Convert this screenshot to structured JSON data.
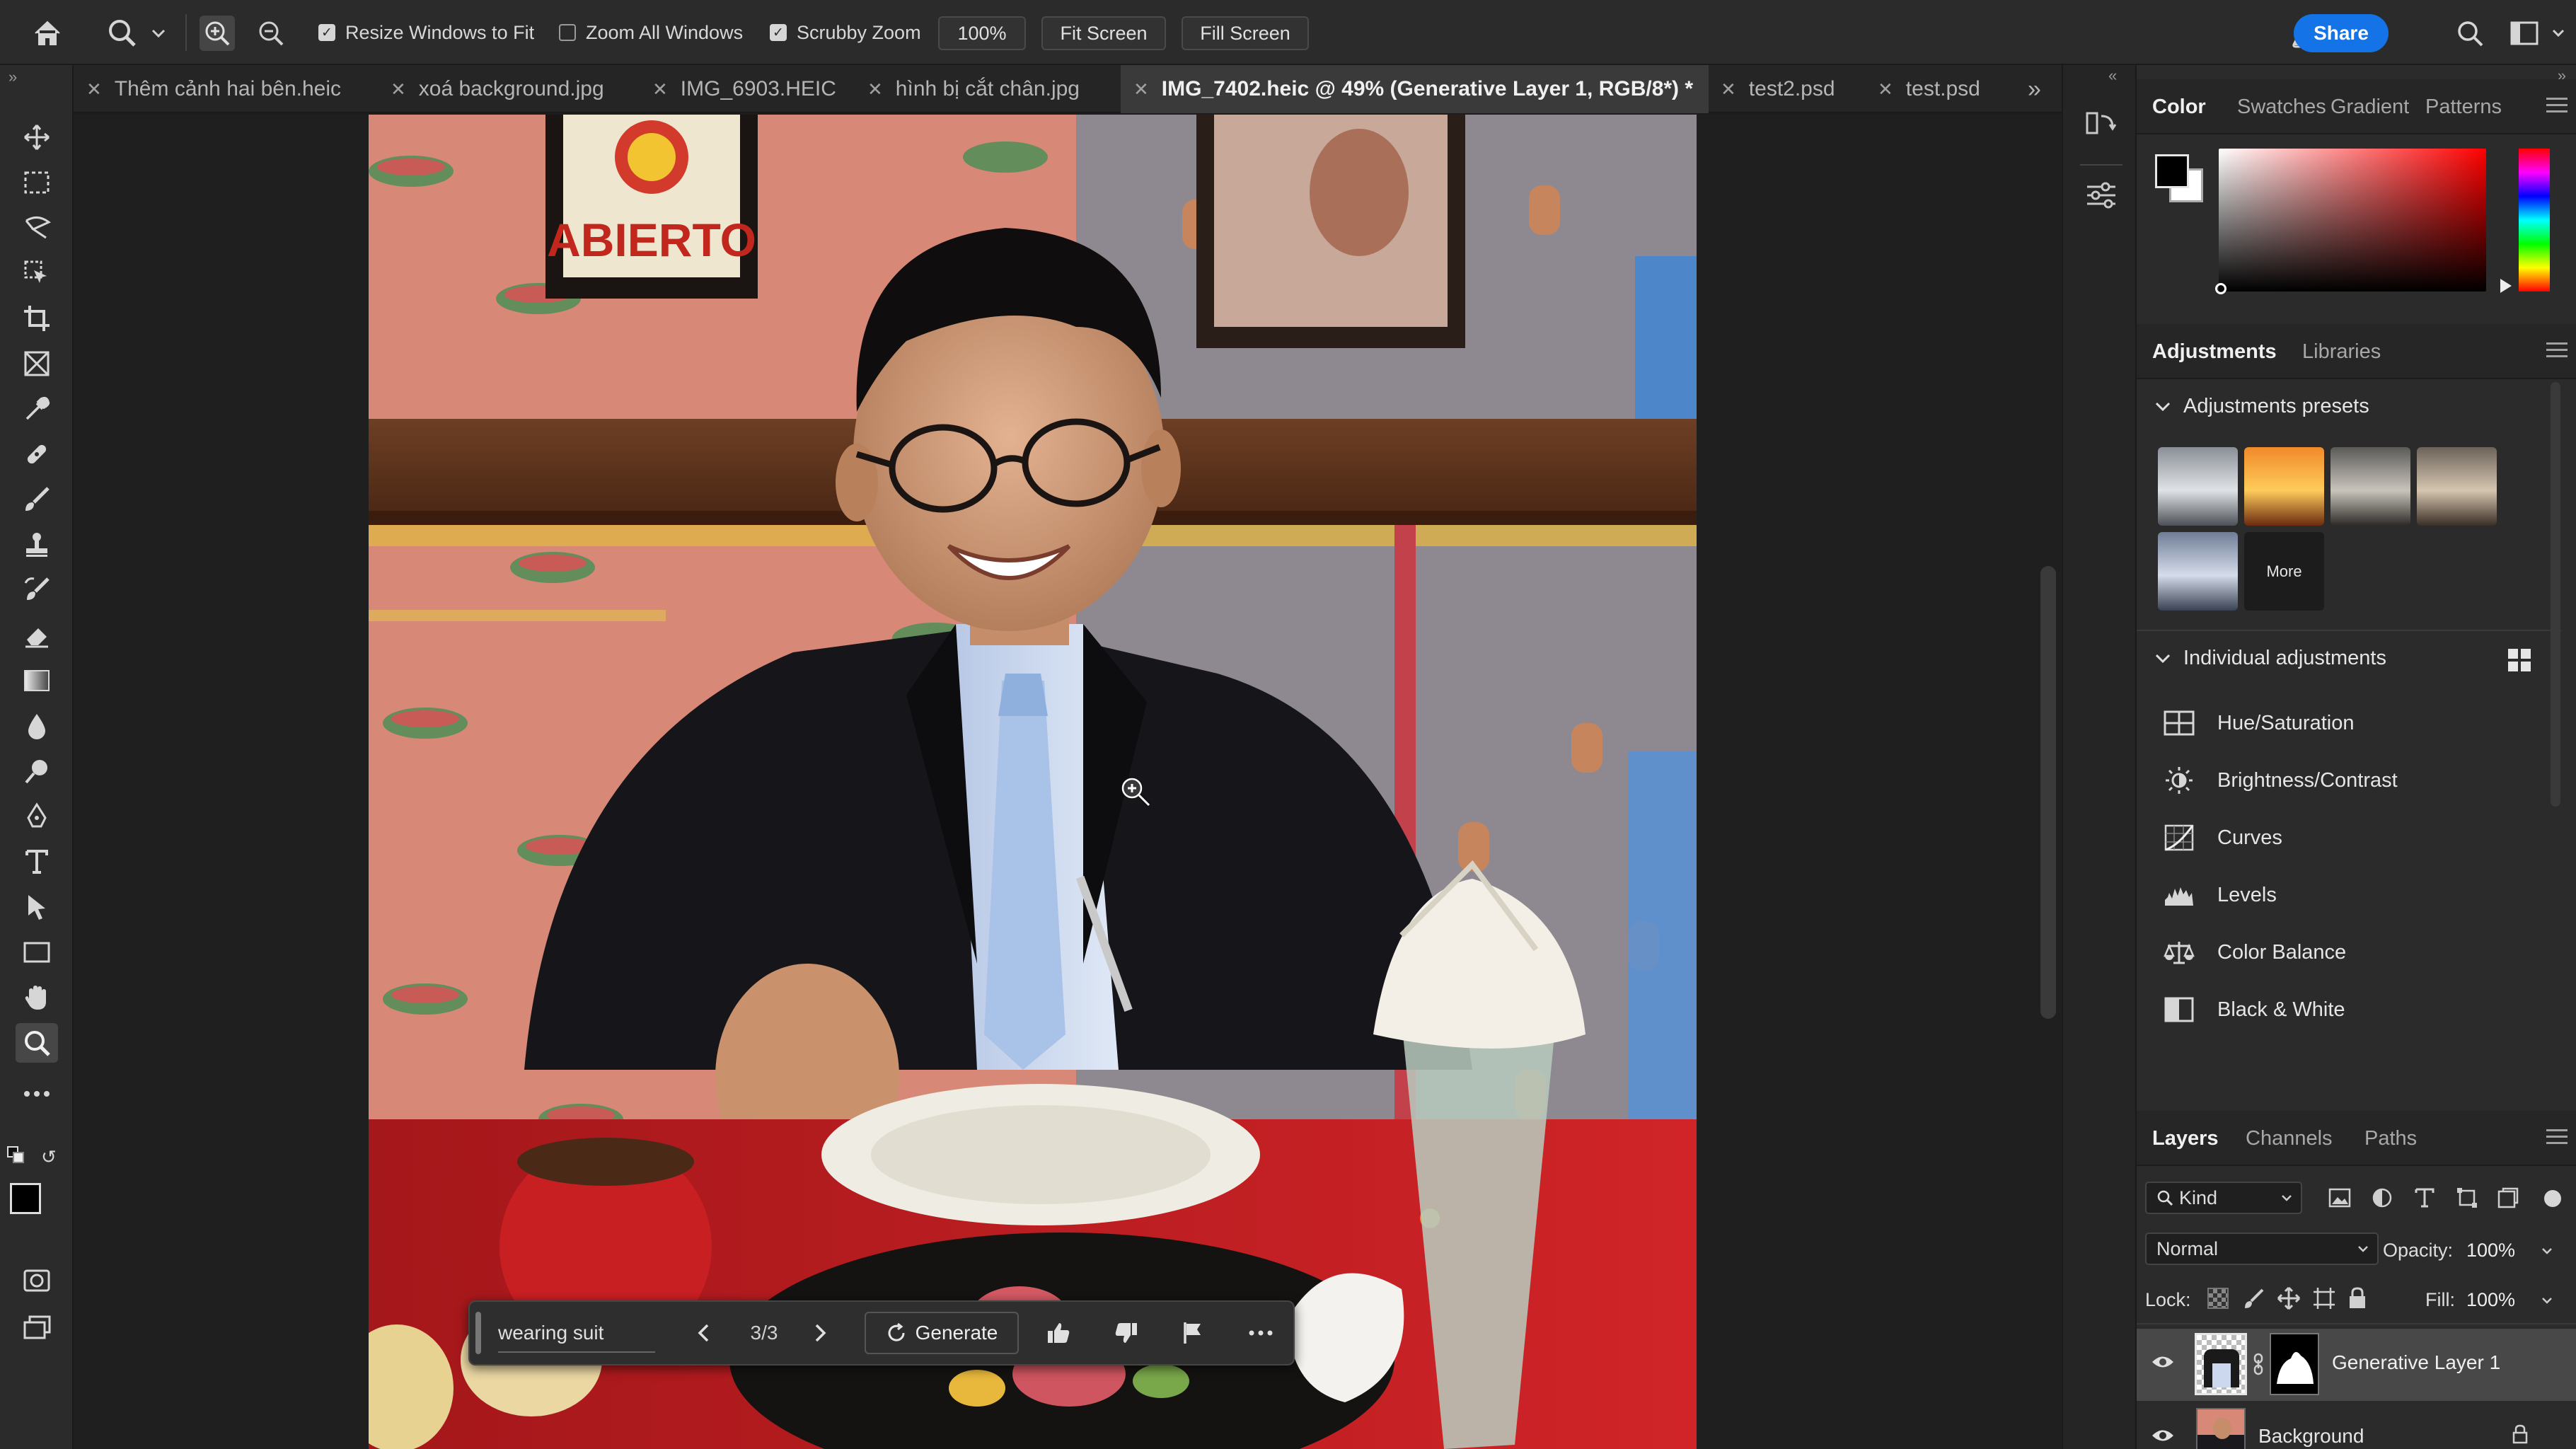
{
  "options_bar": {
    "resize_windows": "Resize Windows to Fit",
    "zoom_all": "Zoom All Windows",
    "scrubby_zoom": "Scrubby Zoom",
    "zoom_value": "100%",
    "fit_screen": "Fit Screen",
    "fill_screen": "Fill Screen",
    "share": "Share",
    "resize_checked": true,
    "zoom_all_checked": false,
    "scrubby_checked": true
  },
  "tabs": [
    {
      "label": "Thêm cảnh hai bên.heic"
    },
    {
      "label": "xoá background.jpg"
    },
    {
      "label": "IMG_6903.HEIC"
    },
    {
      "label": "hình bị cắt chân.jpg"
    },
    {
      "label": "IMG_7402.heic @ 49% (Generative Layer 1, RGB/8*) *"
    },
    {
      "label": "test2.psd"
    },
    {
      "label": "test.psd"
    }
  ],
  "photo": {
    "sign_text": "ABIERTO"
  },
  "context_bar": {
    "prompt": "wearing suit",
    "counter": "3/3",
    "generate": "Generate"
  },
  "color_panel": {
    "tabs": [
      "Color",
      "Swatches",
      "Gradient",
      "Patterns"
    ]
  },
  "adjustments_panel": {
    "tabs": [
      "Adjustments",
      "Libraries"
    ],
    "presets_title": "Adjustments presets",
    "more_label": "More",
    "individual_title": "Individual adjustments",
    "items": [
      {
        "label": "Hue/Saturation",
        "icon": "hue-saturation-icon"
      },
      {
        "label": "Brightness/Contrast",
        "icon": "brightness-icon"
      },
      {
        "label": "Curves",
        "icon": "curves-icon"
      },
      {
        "label": "Levels",
        "icon": "levels-icon"
      },
      {
        "label": "Color Balance",
        "icon": "color-balance-icon"
      },
      {
        "label": "Black & White",
        "icon": "black-white-icon"
      }
    ]
  },
  "layers_panel": {
    "tabs": [
      "Layers",
      "Channels",
      "Paths"
    ],
    "filter_kind": "Kind",
    "blend_mode": "Normal",
    "opacity_label": "Opacity:",
    "opacity_value": "100%",
    "lock_label": "Lock:",
    "fill_label": "Fill:",
    "fill_value": "100%",
    "layers": [
      {
        "name": "Generative Layer 1"
      },
      {
        "name": "Background"
      }
    ]
  },
  "colors": {
    "accent": "#1473e6",
    "panel_bg": "#2b2b2b"
  }
}
